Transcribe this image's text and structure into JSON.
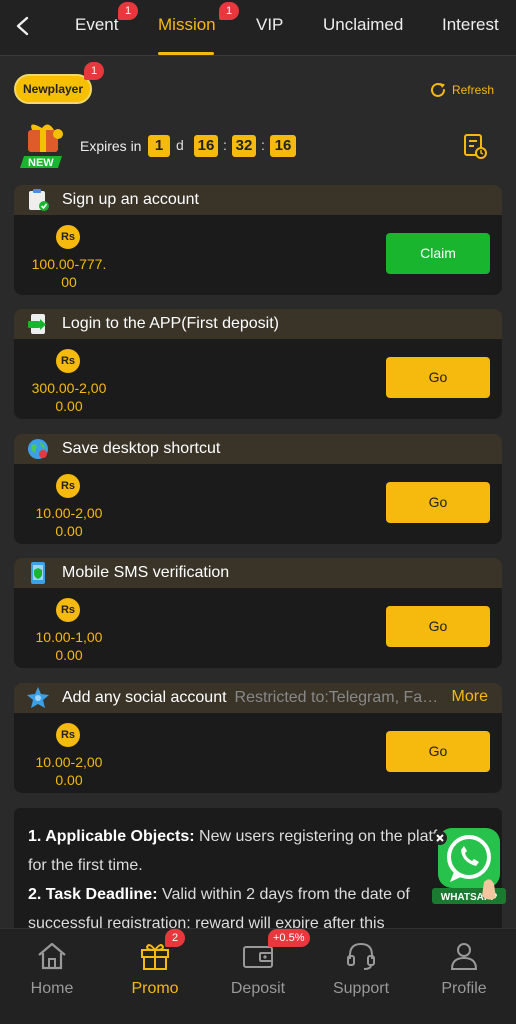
{
  "topbar": {
    "tabs": [
      {
        "label": "Event",
        "badge": "1"
      },
      {
        "label": "Mission",
        "badge": "1",
        "active": true
      },
      {
        "label": "VIP"
      },
      {
        "label": "Unclaimed"
      },
      {
        "label": "Interest"
      }
    ]
  },
  "header": {
    "newplayer_label": "Newplayer",
    "newplayer_badge": "1",
    "refresh_label": "Refresh",
    "new_tag": "NEW",
    "expires_label": "Expires in",
    "timer": {
      "days": "1",
      "day_unit": "d",
      "hours": "16",
      "minutes": "32",
      "seconds": "16"
    }
  },
  "tasks": [
    {
      "title": "Sign up an account",
      "currency": "Rs",
      "amount_line1": "100.00-777.",
      "amount_line2": "00",
      "action": "Claim",
      "icon": "clipboard-check-icon"
    },
    {
      "title": "Login to the APP(First deposit)",
      "currency": "Rs",
      "amount_line1": "300.00-2,00",
      "amount_line2": "0.00",
      "action": "Go",
      "icon": "app-login-icon"
    },
    {
      "title": "Save desktop shortcut",
      "currency": "Rs",
      "amount_line1": "10.00-2,00",
      "amount_line2": "0.00",
      "action": "Go",
      "icon": "globe-icon"
    },
    {
      "title": "Mobile SMS verification",
      "currency": "Rs",
      "amount_line1": "10.00-1,00",
      "amount_line2": "0.00",
      "action": "Go",
      "icon": "phone-shield-icon"
    },
    {
      "title": "Add any social account",
      "restricted": "Restricted to:Telegram, Facebook",
      "more": "More",
      "currency": "Rs",
      "amount_line1": "10.00-2,00",
      "amount_line2": "0.00",
      "action": "Go",
      "icon": "social-star-icon"
    }
  ],
  "rules": {
    "item1_title": "1. Applicable Objects:",
    "item1_text": " New users registering on the platform for the first time.",
    "item2_title": "2. Task Deadline:",
    "item2_text": " Valid within 2 days from the date of successful registration; reward will expire after this"
  },
  "whatsapp": {
    "label": "WHATSAPP"
  },
  "bottomnav": {
    "items": [
      {
        "label": "Home"
      },
      {
        "label": "Promo",
        "badge": "2",
        "active": true
      },
      {
        "label": "Deposit",
        "badge": "+0.5%"
      },
      {
        "label": "Support"
      },
      {
        "label": "Profile"
      }
    ]
  },
  "colors": {
    "accent": "#f6b90e",
    "claim": "#19b52e",
    "badge": "#e8383d",
    "background": "#2a2a2a"
  }
}
